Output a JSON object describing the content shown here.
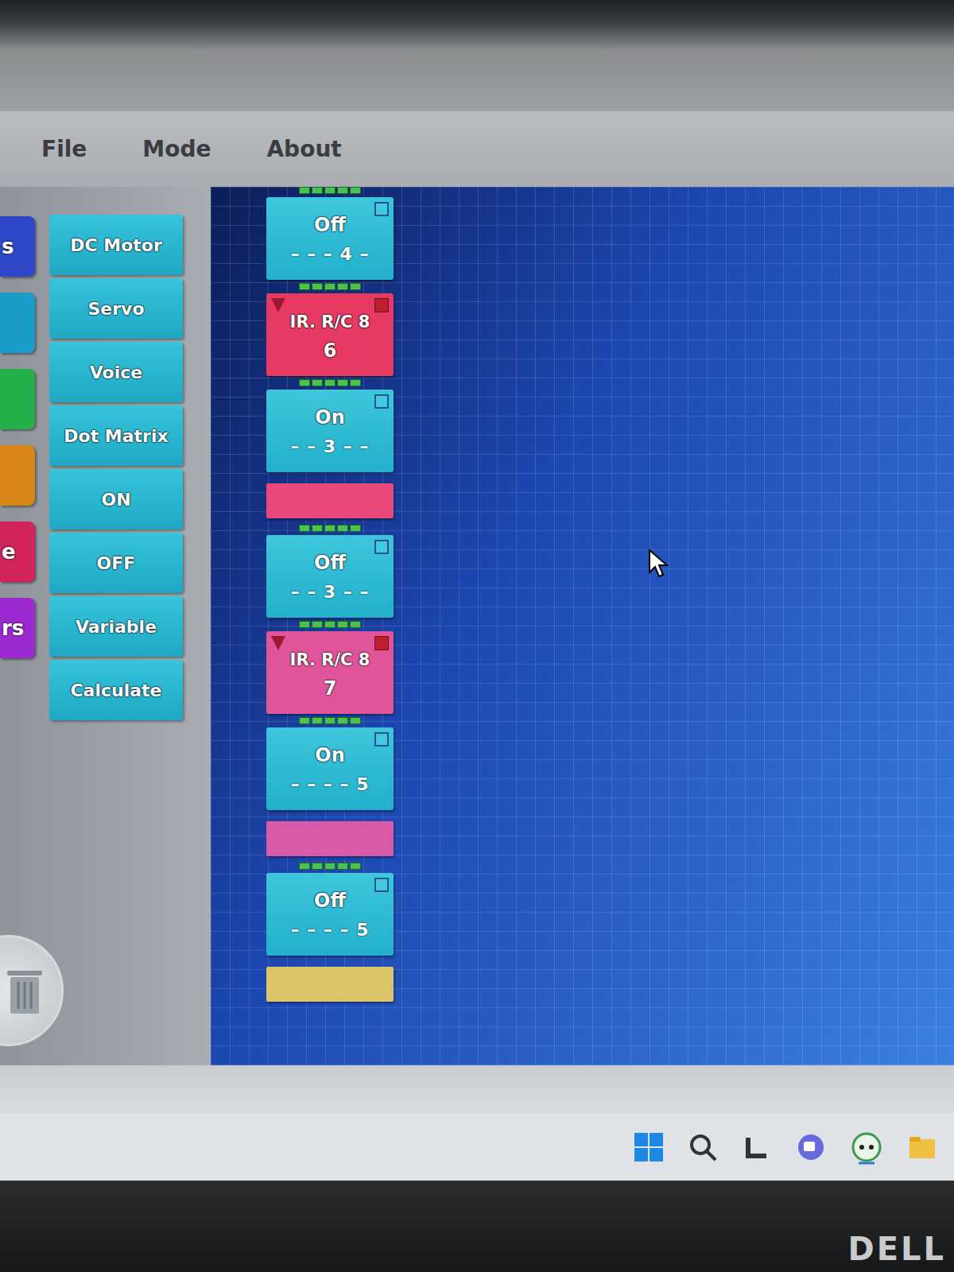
{
  "window": {
    "menu": [
      "File",
      "Mode",
      "About"
    ]
  },
  "categories": [
    {
      "label": "s",
      "color": "#2f47c9"
    },
    {
      "label": "",
      "color": "#1a9ec8"
    },
    {
      "label": "",
      "color": "#25b04a"
    },
    {
      "label": "",
      "color": "#d8861a"
    },
    {
      "label": "e",
      "color": "#d0245a"
    },
    {
      "label": "rs",
      "color": "#9b2bd0"
    }
  ],
  "palette": [
    "DC Motor",
    "Servo",
    "Voice",
    "Dot Matrix",
    "ON",
    "OFF",
    "Variable",
    "Calculate"
  ],
  "blocks": [
    {
      "kind": "output",
      "label": "Off",
      "line": "– – – 4 –",
      "checked": false
    },
    {
      "kind": "ir",
      "label": "IR. R/C 8",
      "value": "6",
      "color": "#e63a62"
    },
    {
      "kind": "output",
      "label": "On",
      "line": "– – 3 – –",
      "checked": false
    },
    {
      "kind": "end",
      "color": "#e8487a"
    },
    {
      "kind": "output",
      "label": "Off",
      "line": "– – 3 – –",
      "checked": false
    },
    {
      "kind": "ir",
      "label": "IR. R/C 8",
      "value": "7",
      "color": "#e0559a"
    },
    {
      "kind": "output",
      "label": "On",
      "line": "– – – – 5",
      "checked": false
    },
    {
      "kind": "end",
      "color": "#d85aa8"
    },
    {
      "kind": "output",
      "label": "Off",
      "line": "– – – – 5",
      "checked": false
    },
    {
      "kind": "end",
      "color": "#dcc46a"
    }
  ],
  "brand": "DELL"
}
